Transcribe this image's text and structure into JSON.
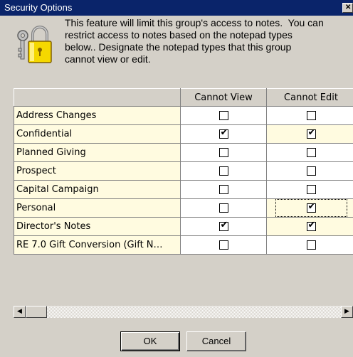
{
  "window": {
    "title": "Security Options",
    "close_label": "✕"
  },
  "description": "This feature will limit this group's access to notes.  You can\nrestrict access to notes based on the notepad types\nbelow.. Designate the notepad types that this group\ncannot view or edit.",
  "grid": {
    "headers": [
      "",
      "Cannot View",
      "Cannot Edit"
    ],
    "rows": [
      {
        "name": "Address Changes",
        "cannot_view": false,
        "cannot_edit": false
      },
      {
        "name": "Confidential",
        "cannot_view": true,
        "cannot_edit": true
      },
      {
        "name": "Planned Giving",
        "cannot_view": false,
        "cannot_edit": false
      },
      {
        "name": "Prospect",
        "cannot_view": false,
        "cannot_edit": false
      },
      {
        "name": "Capital Campaign",
        "cannot_view": false,
        "cannot_edit": false
      },
      {
        "name": "Personal",
        "cannot_view": false,
        "cannot_edit": true
      },
      {
        "name": "Director's Notes",
        "cannot_view": true,
        "cannot_edit": true
      },
      {
        "name": "RE 7.0 Gift Conversion (Gift N…",
        "cannot_view": false,
        "cannot_edit": false
      }
    ],
    "focused_row": 5
  },
  "scrollbar": {
    "left_arrow": "◀",
    "right_arrow": "▶"
  },
  "buttons": {
    "ok": "OK",
    "cancel": "Cancel"
  },
  "icons": {
    "lock": "lock-keys-icon",
    "check": "✔"
  }
}
